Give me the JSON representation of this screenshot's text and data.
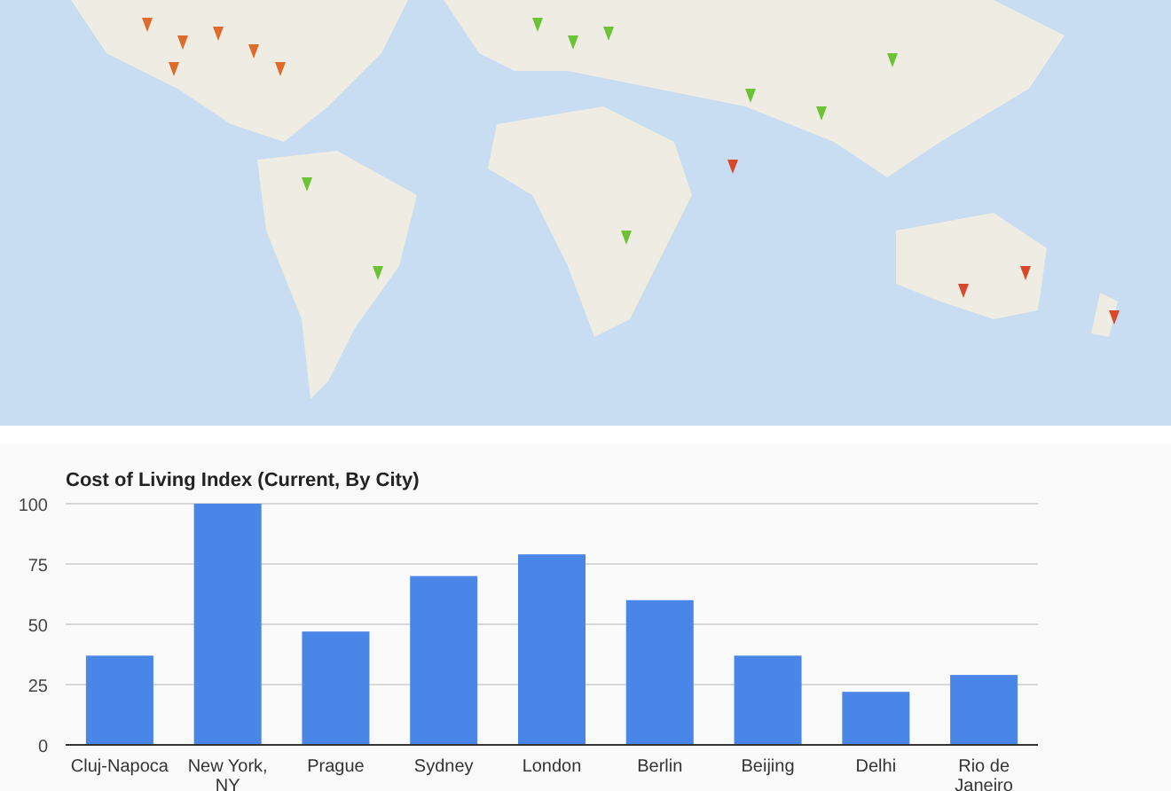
{
  "chart": {
    "chart_data": {
      "type": "bar",
      "title": "Cost of Living Index (Current, By City)",
      "categories": [
        "Cluj-Napoca",
        "New York, NY",
        "Prague",
        "Sydney",
        "London",
        "Berlin",
        "Beijing",
        "Delhi",
        "Rio de Janeiro"
      ],
      "series": [
        {
          "color": "#4a86e8",
          "values": [
            37,
            100,
            47,
            70,
            79,
            60,
            37,
            22,
            29
          ]
        }
      ],
      "ylim": [
        0,
        100
      ],
      "grid": true,
      "yticks": [
        0,
        25,
        50,
        75,
        100
      ]
    }
  }
}
